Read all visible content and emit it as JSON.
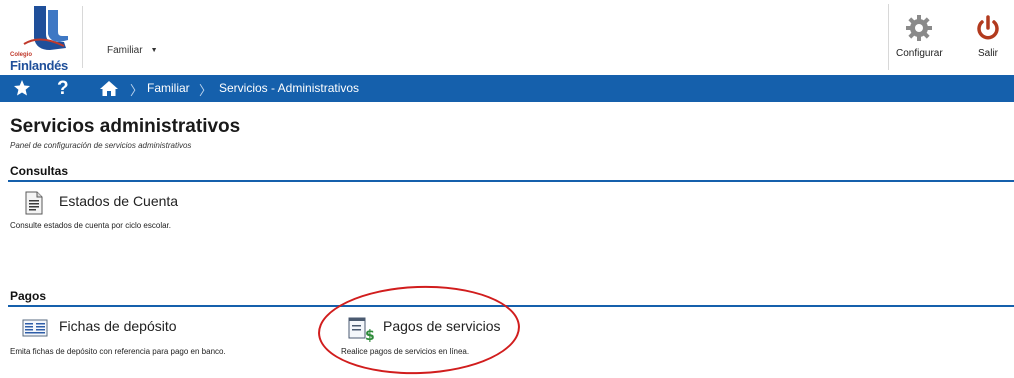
{
  "header": {
    "logo_small": "Colegio",
    "logo_text": "Finlandés",
    "profile": "Familiar",
    "config_label": "Configurar",
    "salir_label": "Salir"
  },
  "nav": {
    "help": "?",
    "crumbs": [
      "Familiar",
      "Servicios - Administrativos"
    ],
    "separator": "〉"
  },
  "page": {
    "title": "Servicios administrativos",
    "subtitle": "Panel de configuración de servicios administrativos"
  },
  "sections": {
    "consultas": {
      "title": "Consultas",
      "items": [
        {
          "title": "Estados de Cuenta",
          "desc": "Consulte estados de cuenta por ciclo escolar.",
          "icon": "document-icon"
        }
      ]
    },
    "pagos": {
      "title": "Pagos",
      "items": [
        {
          "title": "Fichas de depósito",
          "desc": "Emita fichas de depósito con referencia para pago en banco.",
          "icon": "deposit-slip-icon"
        },
        {
          "title": "Pagos de servicios",
          "desc": "Realice pagos de servicios en línea.",
          "icon": "payment-icon"
        }
      ]
    }
  },
  "colors": {
    "brand_blue": "#1560ac",
    "highlight_red": "#d11d1d",
    "power_red": "#b23a1e"
  }
}
